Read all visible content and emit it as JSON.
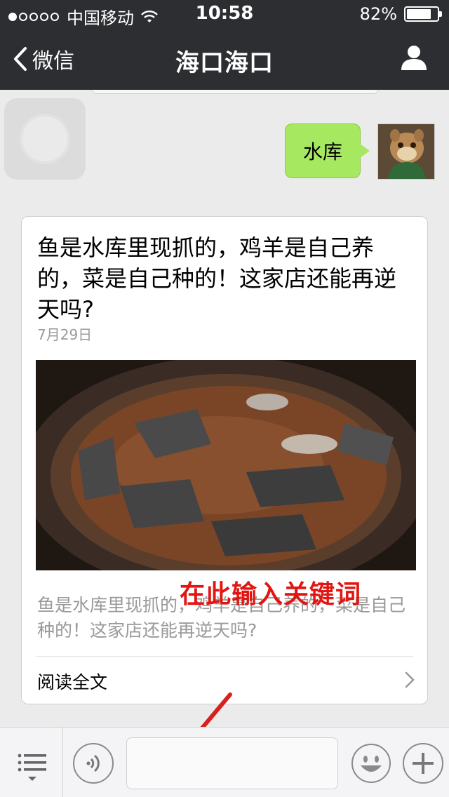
{
  "status_bar": {
    "carrier": "中国移动",
    "time": "10:58",
    "battery": "82%",
    "battery_level": 0.82,
    "signal_bars": 1,
    "signal_total": 5
  },
  "nav": {
    "back_label": "微信",
    "title": "海口海口",
    "icons": {
      "back": "chevron-left-icon",
      "profile": "user-icon"
    }
  },
  "chat": {
    "my_message": "水库",
    "colors": {
      "bubble": "#a6e860",
      "background": "#ebebeb",
      "nav": "#2d2e32"
    }
  },
  "article": {
    "title": "鱼是水库里现抓的，鸡羊是自己养的，菜是自己种的！这家店还能再逆天吗?",
    "date": "7月29日",
    "description": "鱼是水库里现抓的，鸡羊是自己养的，菜是自己种的！这家店还能再逆天吗?",
    "read_more": "阅读全文"
  },
  "annotation": {
    "text": "在此输入关键词",
    "color": "#e11612"
  },
  "input_bar": {
    "input_value": "",
    "icons": {
      "menu": "menu-list-icon",
      "voice": "voice-icon",
      "emoji": "emoji-icon",
      "plus": "plus-icon"
    }
  }
}
